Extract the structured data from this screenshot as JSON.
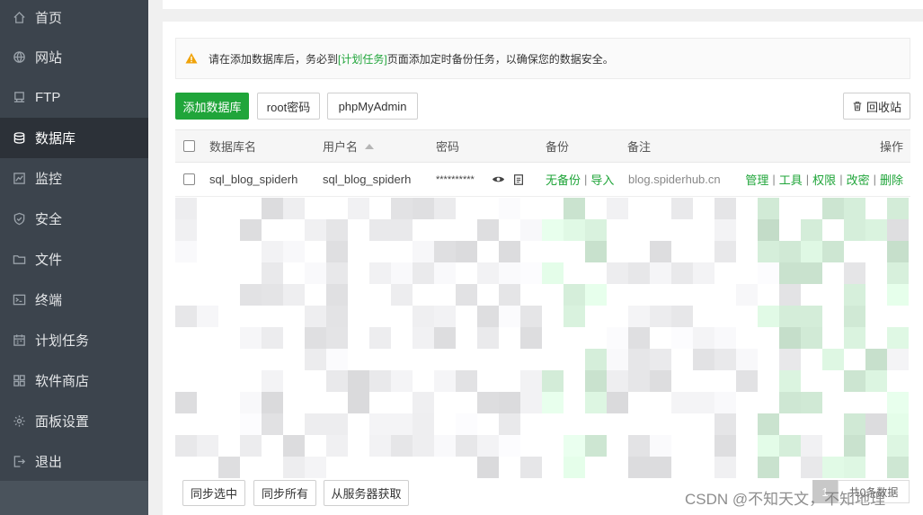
{
  "sidebar": {
    "items": [
      {
        "label": "首页",
        "icon": "home-icon"
      },
      {
        "label": "网站",
        "icon": "globe-icon"
      },
      {
        "label": "FTP",
        "icon": "ftp-icon"
      },
      {
        "label": "数据库",
        "icon": "database-icon",
        "active": true
      },
      {
        "label": "监控",
        "icon": "monitor-icon"
      },
      {
        "label": "安全",
        "icon": "shield-icon"
      },
      {
        "label": "文件",
        "icon": "folder-icon"
      },
      {
        "label": "终端",
        "icon": "terminal-icon"
      },
      {
        "label": "计划任务",
        "icon": "calendar-icon"
      },
      {
        "label": "软件商店",
        "icon": "apps-icon"
      },
      {
        "label": "面板设置",
        "icon": "gear-icon"
      },
      {
        "label": "退出",
        "icon": "logout-icon"
      }
    ]
  },
  "notice": {
    "before": "请在添加数据库后，务必到",
    "link": "[计划任务]",
    "after": "页面添加定时备份任务，以确保您的数据安全。"
  },
  "toolbar": {
    "add_db": "添加数据库",
    "root_pwd": "root密码",
    "phpmyadmin": "phpMyAdmin",
    "recycle": "回收站"
  },
  "table": {
    "headers": {
      "name": "数据库名",
      "user": "用户名",
      "password": "密码",
      "backup": "备份",
      "note": "备注",
      "ops": "操作"
    },
    "rows": [
      {
        "name": "sql_blog_spiderh",
        "user": "sql_blog_spiderh",
        "password": "**********",
        "backup_status": "无备份",
        "import": "导入",
        "note": "blog.spiderhub.cn",
        "ops": [
          "管理",
          "工具",
          "权限",
          "改密",
          "删除"
        ]
      }
    ]
  },
  "footer": {
    "sync_selected": "同步选中",
    "sync_all": "同步所有",
    "fetch_server": "从服务器获取",
    "page": "1",
    "total": "共0条数据"
  },
  "watermark": "CSDN @不知天文，不知地理",
  "colors": {
    "accent": "#20a53a",
    "sidebar_bg": "#3c444d",
    "sidebar_active": "#2c3138",
    "warning": "#f0a30a"
  }
}
